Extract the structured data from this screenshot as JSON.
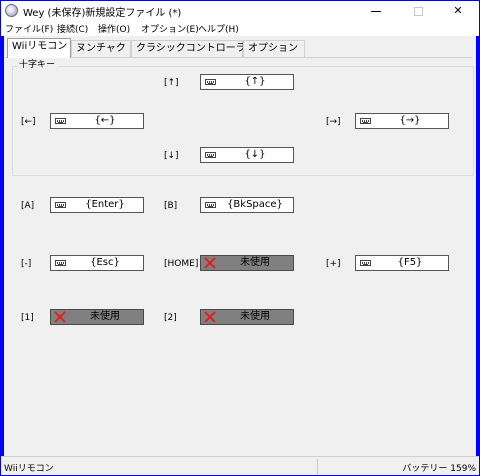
{
  "window": {
    "title": "Wey (未保存)新規設定ファイル (*)",
    "minimize_glyph": "",
    "close_glyph": "✕"
  },
  "menu": [
    {
      "label": "ファイル(F)"
    },
    {
      "label": "接続(C)"
    },
    {
      "label": "操作(O)"
    },
    {
      "label": "オプション(E)"
    },
    {
      "label": "ヘルプ(H)"
    }
  ],
  "tabs": [
    {
      "label": "Wiiリモコン",
      "active": true
    },
    {
      "label": "ヌンチャク",
      "active": false
    },
    {
      "label": "クラシックコントローラ",
      "active": false
    },
    {
      "label": "オプション",
      "active": false
    }
  ],
  "dpad_group": {
    "legend": "十字キー",
    "up": {
      "label": "[↑]",
      "value": "{↑}"
    },
    "left": {
      "label": "[←]",
      "value": "{←}"
    },
    "right": {
      "label": "[→]",
      "value": "{→}"
    },
    "down": {
      "label": "[↓]",
      "value": "{↓}"
    }
  },
  "buttons": {
    "a": {
      "label": "[A]",
      "value": "{Enter}",
      "assigned": true
    },
    "b": {
      "label": "[B]",
      "value": "{BkSpace}",
      "assigned": true
    },
    "minus": {
      "label": "[-]",
      "value": "{Esc}",
      "assigned": true
    },
    "home": {
      "label": "[HOME]",
      "value": "未使用",
      "assigned": false
    },
    "plus": {
      "label": "[+]",
      "value": "{F5}",
      "assigned": true
    },
    "one": {
      "label": "[1]",
      "value": "未使用",
      "assigned": false
    },
    "two": {
      "label": "[2]",
      "value": "未使用",
      "assigned": false
    }
  },
  "icons": {
    "keyboard": "keyboard-icon",
    "unused": "x-icon",
    "unused_color": "#e02020"
  },
  "statusbar": {
    "left": "Wiiリモコン",
    "right": "バッテリー 159%"
  }
}
